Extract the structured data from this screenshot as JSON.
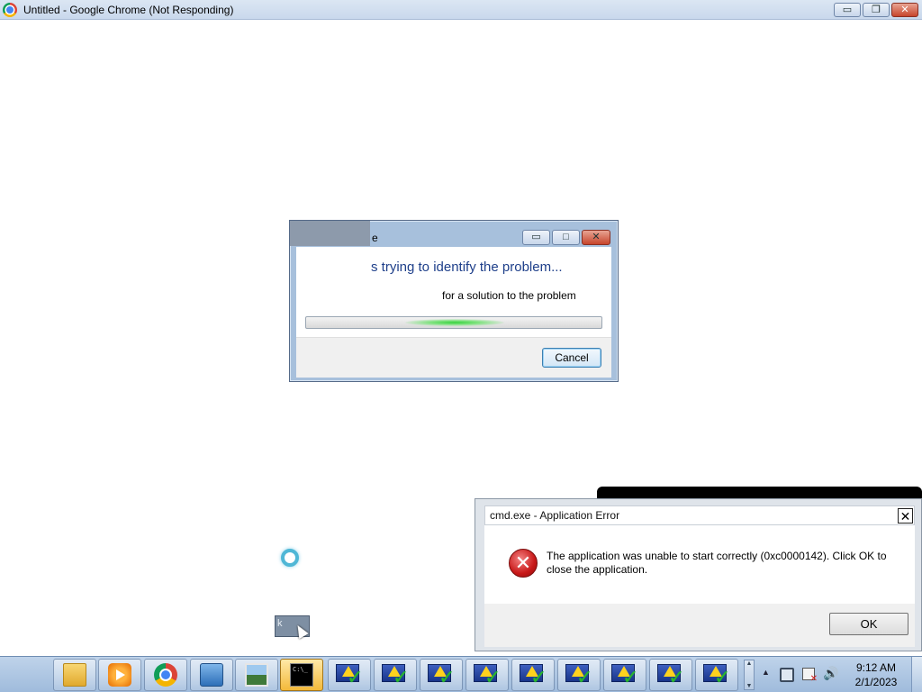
{
  "chrome_window": {
    "title": "Untitled - Google Chrome (Not Responding)",
    "min_glyph": "▭",
    "max_glyph": "❐",
    "close_glyph": "✕"
  },
  "wer_dialog": {
    "title_fragment": "e",
    "heading": "s trying to identify the problem...",
    "subtext": "for a solution to the problem",
    "cancel_label": "Cancel",
    "min_glyph": "▭",
    "max_glyph": "□",
    "close_glyph": "✕"
  },
  "error_dialog": {
    "title": "cmd.exe - Application Error",
    "close_glyph": "✕",
    "icon": "error-x-icon",
    "message": "The application was unable to start correctly (0xc0000142). Click OK to close the application.",
    "ok_label": "OK"
  },
  "fragment": {
    "text": "k"
  },
  "taskbar": {
    "items": [
      {
        "icon": "folder-icon"
      },
      {
        "icon": "media-player-icon"
      },
      {
        "icon": "chrome-icon"
      },
      {
        "icon": "remote-desktop-icon"
      },
      {
        "icon": "photo-viewer-icon"
      },
      {
        "icon": "cmd-icon",
        "text": "C:\\_",
        "active": true
      },
      {
        "icon": "warning-check-icon"
      },
      {
        "icon": "warning-check-icon"
      },
      {
        "icon": "warning-check-icon"
      },
      {
        "icon": "warning-check-icon"
      },
      {
        "icon": "warning-check-icon"
      },
      {
        "icon": "warning-check-icon"
      },
      {
        "icon": "warning-check-icon"
      },
      {
        "icon": "warning-check-icon"
      },
      {
        "icon": "warning-check-icon"
      }
    ],
    "scroll_up": "▲",
    "scroll_down": "▼",
    "tray_up": "▲",
    "volume_glyph": "🔊"
  },
  "clock": {
    "time": "9:12 AM",
    "date": "2/1/2023"
  }
}
